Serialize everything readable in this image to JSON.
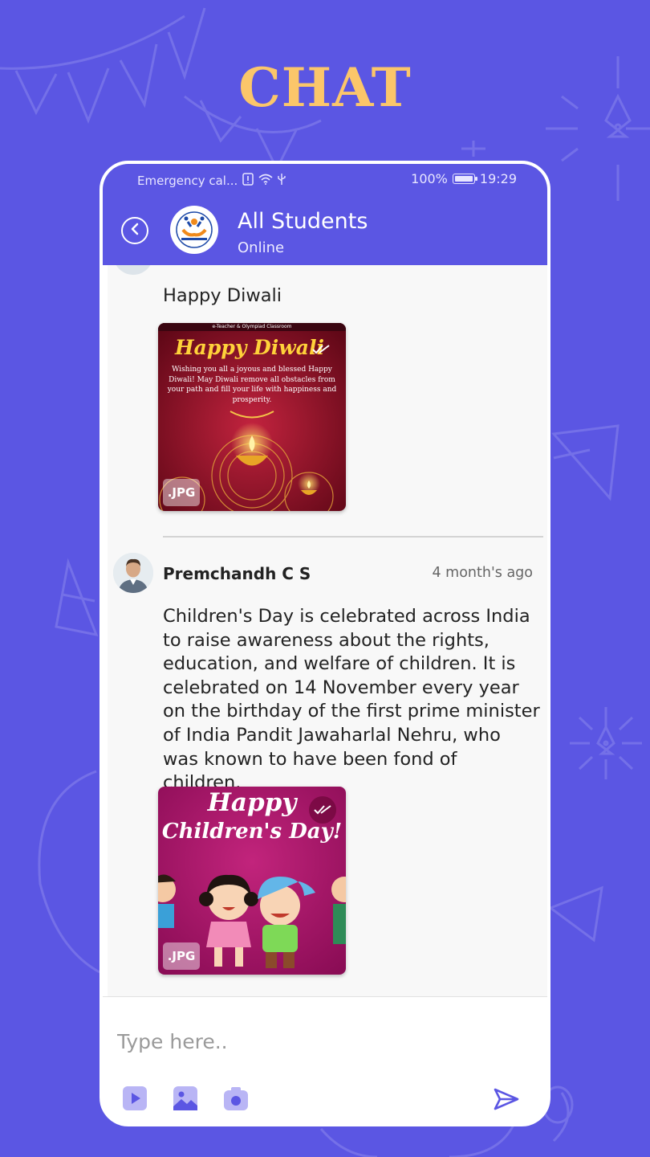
{
  "promo": {
    "title": "CHAT"
  },
  "statusbar": {
    "carrier": "Emergency cal...",
    "battery": "100%",
    "time": "19:29"
  },
  "header": {
    "title": "All Students",
    "subtitle": "Online"
  },
  "messages": [
    {
      "text": "Happy Diwali",
      "attachment": {
        "type": "image",
        "badge": ".JPG",
        "heading": "Happy Diwali",
        "banner": "e-Teacher & Olympiad Classroom",
        "body": "Wishing you all a joyous and blessed Happy Diwali! May Diwali remove all obstacles from your path and fill your life with happiness and prosperity."
      }
    },
    {
      "sender": "Premchandh C S",
      "timestamp": "4 month's ago",
      "text": "Children's Day is celebrated across India to raise awareness about the rights, education, and welfare of children. It is celebrated on 14 November every year on the birthday of the first prime minister of India Pandit Jawaharlal Nehru, who was known to have been fond of children.",
      "attachment": {
        "type": "image",
        "badge": ".JPG",
        "heading_line1": "Happy",
        "heading_line2": "Children's Day!"
      }
    }
  ],
  "composer": {
    "placeholder": "Type here..",
    "tools": [
      "video-icon",
      "image-icon",
      "camera-icon"
    ],
    "send_icon": "send-icon"
  },
  "colors": {
    "background": "#5b56e3",
    "accent": "#5b56e3",
    "title": "#fbc66a",
    "tool_bg": "#b9b5f5"
  }
}
